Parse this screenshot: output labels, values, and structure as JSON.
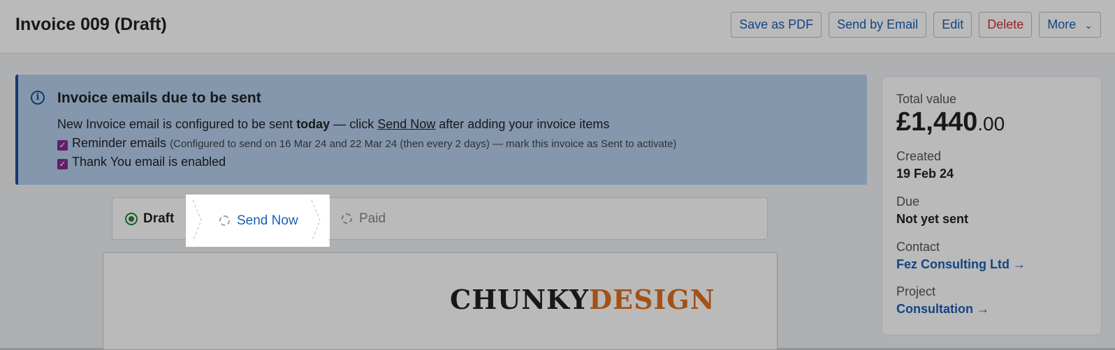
{
  "header": {
    "title": "Invoice 009 (Draft)",
    "actions": {
      "save_pdf": "Save as PDF",
      "send_email": "Send by Email",
      "edit": "Edit",
      "delete": "Delete",
      "more": "More"
    }
  },
  "banner": {
    "title": "Invoice emails due to be sent",
    "line1_prefix": "New Invoice email is configured to be sent ",
    "line1_bold": "today",
    "line1_mid": " — click ",
    "line1_link": "Send Now",
    "line1_suffix": " after adding your invoice items",
    "reminder_label": "Reminder emails",
    "reminder_detail": "(Configured to send on 16 Mar 24 and 22 Mar 24 (then every 2 days) — mark this invoice as Sent to activate)",
    "thankyou_label": "Thank You email is enabled",
    "icons": {
      "info": "info-icon",
      "checkbox": "checked-checkbox"
    },
    "colors": {
      "background": "#b5d0ee",
      "accent": "#1d4e96",
      "checkbox": "#8a2a8e"
    }
  },
  "steps": {
    "draft": "Draft",
    "send_now": "Send Now",
    "paid": "Paid"
  },
  "document": {
    "logo_part1": "CHUNKY",
    "logo_part2": "DESIGN"
  },
  "sidebar": {
    "total_label": "Total value",
    "total_main": "£1,440",
    "total_pence": ".00",
    "created_label": "Created",
    "created_value": "19 Feb 24",
    "due_label": "Due",
    "due_value": "Not yet sent",
    "contact_label": "Contact",
    "contact_value": "Fez Consulting Ltd →",
    "project_label": "Project",
    "project_value": "Consultation →"
  }
}
